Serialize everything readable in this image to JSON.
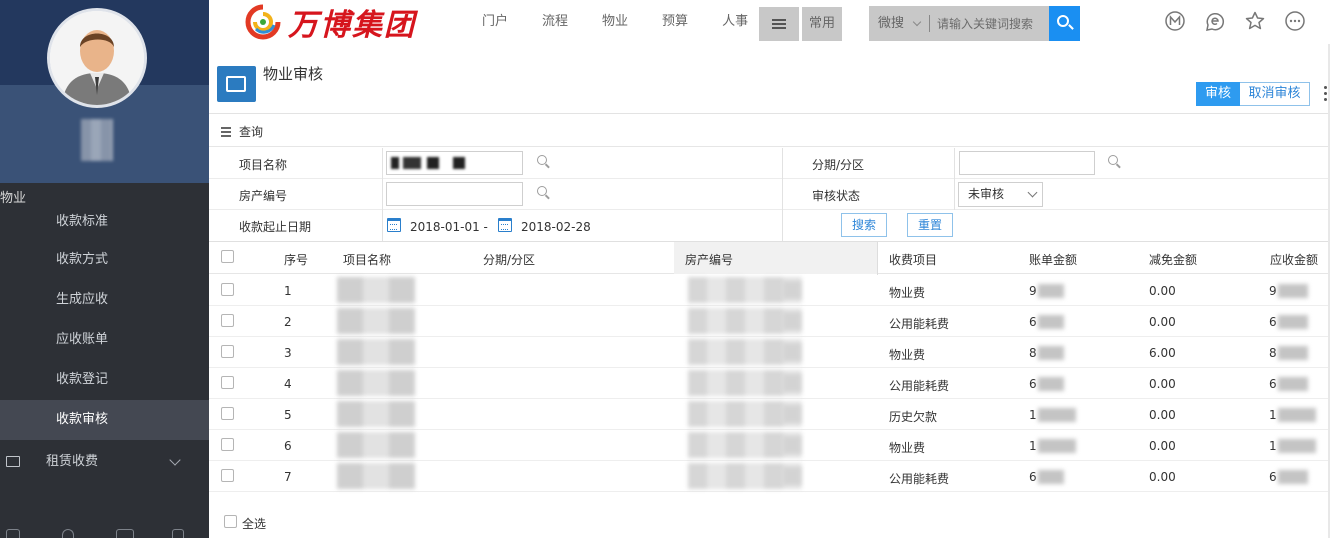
{
  "sidebar": {
    "section_label": "物业",
    "items": [
      {
        "label": "收款标准"
      },
      {
        "label": "收款方式"
      },
      {
        "label": "生成应收"
      },
      {
        "label": "应收账单"
      },
      {
        "label": "收款登记"
      },
      {
        "label": "收款审核",
        "active": true
      }
    ],
    "group_label": "租赁收费"
  },
  "header": {
    "brand": "万博集团",
    "nav": [
      "门户",
      "流程",
      "物业",
      "预算",
      "人事"
    ],
    "common_label": "常用",
    "search_category": "微搜",
    "search_placeholder": "请输入关键词搜索",
    "icons": [
      "m-circle-icon",
      "e-circle-icon",
      "star-icon",
      "more-circle-icon"
    ]
  },
  "page": {
    "title": "物业审核",
    "audit_label": "审核",
    "cancel_audit_label": "取消审核"
  },
  "query": {
    "title": "查询",
    "project_name_label": "项目名称",
    "phase_label": "分期/分区",
    "property_no_label": "房产编号",
    "audit_status_label": "审核状态",
    "audit_status_value": "未审核",
    "date_label": "收款起止日期",
    "date_start": "2018-01-01 -",
    "date_end": "2018-02-28",
    "search_label": "搜索",
    "reset_label": "重置"
  },
  "table": {
    "columns": [
      "序号",
      "项目名称",
      "分期/分区",
      "房产编号",
      "收费项目",
      "账单金额",
      "减免金额",
      "应收金额"
    ],
    "rows": [
      {
        "no": "1",
        "item": "物业费",
        "bill": "9",
        "discount": "0.00",
        "receivable": "9"
      },
      {
        "no": "2",
        "item": "公用能耗费",
        "bill": "6",
        "discount": "0.00",
        "receivable": "6"
      },
      {
        "no": "3",
        "item": "物业费",
        "bill": "8",
        "discount": "6.00",
        "receivable": "8"
      },
      {
        "no": "4",
        "item": "公用能耗费",
        "bill": "6",
        "discount": "0.00",
        "receivable": "6"
      },
      {
        "no": "5",
        "item": "历史欠款",
        "bill": "1",
        "discount": "0.00",
        "receivable": "1"
      },
      {
        "no": "6",
        "item": "物业费",
        "bill": "1",
        "discount": "0.00",
        "receivable": "1"
      },
      {
        "no": "7",
        "item": "公用能耗费",
        "bill": "6",
        "discount": "0.00",
        "receivable": "6"
      }
    ],
    "select_all_label": "全选"
  },
  "colors": {
    "accent": "#1a8ff2",
    "sidebar_bg": "#2d3036",
    "brand_red": "#d6151d"
  }
}
